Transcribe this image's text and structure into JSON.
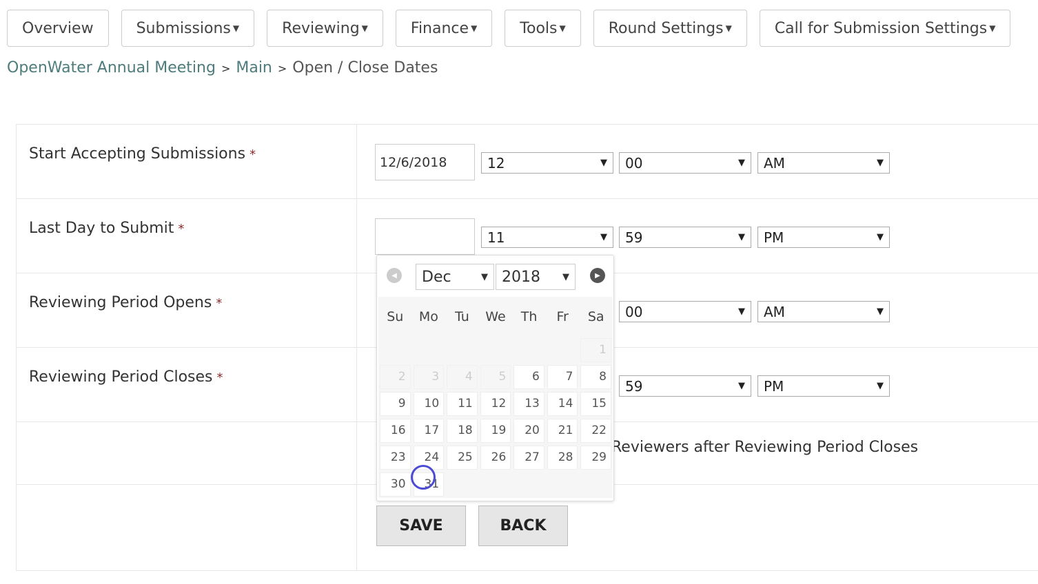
{
  "nav": [
    {
      "label": "Overview",
      "dropdown": false
    },
    {
      "label": "Submissions",
      "dropdown": true
    },
    {
      "label": "Reviewing",
      "dropdown": true
    },
    {
      "label": "Finance",
      "dropdown": true
    },
    {
      "label": "Tools",
      "dropdown": true
    },
    {
      "label": "Round Settings",
      "dropdown": true
    },
    {
      "label": "Call for Submission Settings",
      "dropdown": true
    }
  ],
  "breadcrumb": [
    "OpenWater Annual Meeting",
    "Main",
    "Open / Close Dates"
  ],
  "rows": [
    {
      "label": "Start Accepting Submissions",
      "date": "12/6/2018",
      "hour": "12",
      "minute": "00",
      "ampm": "AM"
    },
    {
      "label": "Last Day to Submit",
      "date": "",
      "hour": "11",
      "minute": "59",
      "ampm": "PM"
    },
    {
      "label": "Reviewing Period Opens",
      "minute": "00",
      "ampm": "AM"
    },
    {
      "label": "Reviewing Period Closes",
      "minute": "59",
      "ampm": "PM"
    }
  ],
  "note": "Reviewers after Reviewing Period Closes",
  "buttons": {
    "save": "SAVE",
    "back": "BACK"
  },
  "required_mark": "*",
  "calendar": {
    "month": "Dec",
    "year": "2018",
    "weekdays": [
      "Su",
      "Mo",
      "Tu",
      "We",
      "Th",
      "Fr",
      "Sa"
    ],
    "leading_blanks": 6,
    "disabled_through": 5,
    "days": 31,
    "hovered": 31
  }
}
